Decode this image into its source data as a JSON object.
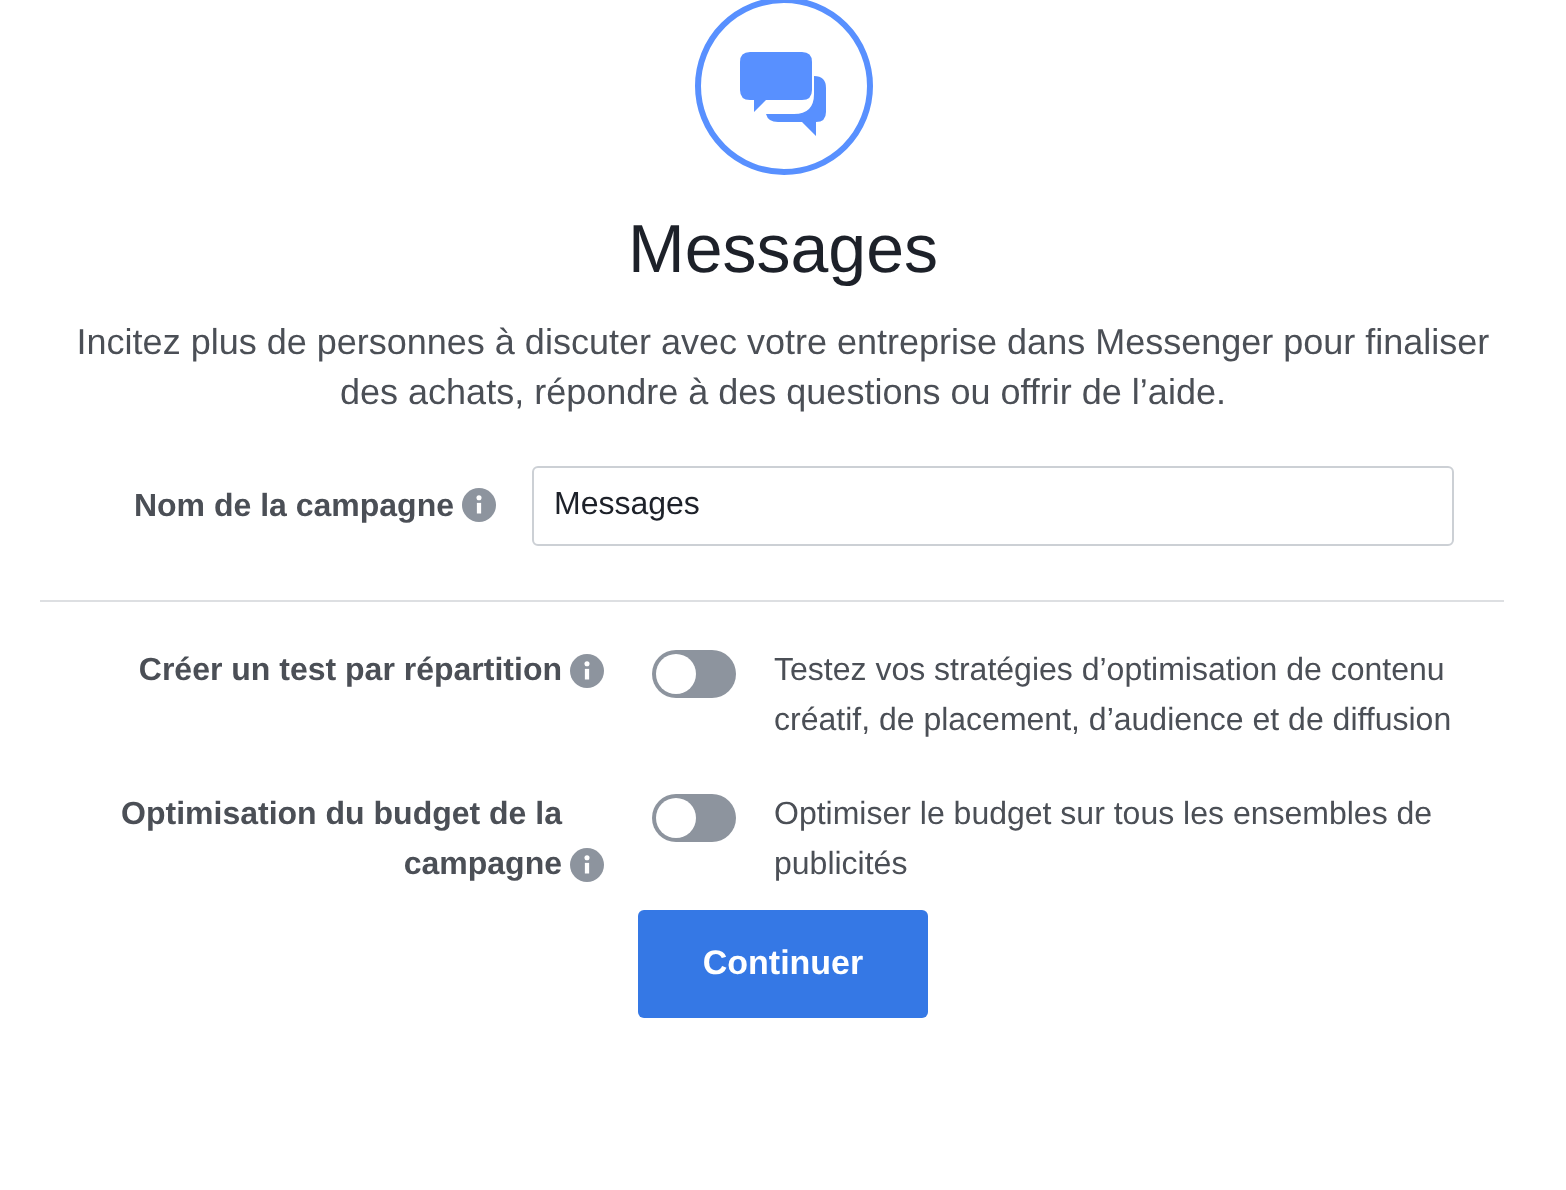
{
  "title": "Messages",
  "description": "Incitez plus de personnes à discuter avec votre entreprise dans Messenger pour finaliser des achats, répondre à des questions ou offrir de l’aide.",
  "campaign_name": {
    "label": "Nom de la campagne",
    "value": "Messages"
  },
  "options": [
    {
      "label": "Créer un test par répartition",
      "on": false,
      "description": "Testez vos stratégies d’optimisation de contenu créatif, de placement, d’audience et de diffusion"
    },
    {
      "label": "Optimisation du budget de la campagne",
      "on": false,
      "description": "Optimiser le budget sur tous les ensembles de publicités"
    }
  ],
  "button": "Continuer"
}
